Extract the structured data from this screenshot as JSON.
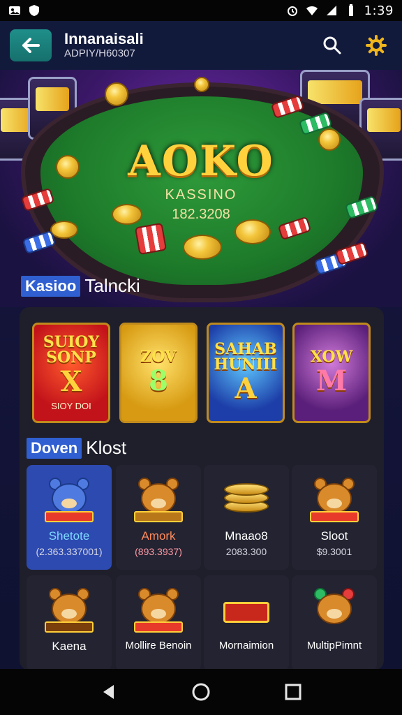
{
  "status_bar": {
    "time": "1:39"
  },
  "header": {
    "title": "Innanaisali",
    "subtitle": "ADPIY/H60307"
  },
  "hero": {
    "logo": "AOKO",
    "subtitle": "KASSINO",
    "amount": "182.3208"
  },
  "section1": {
    "tag": "Kasioo",
    "label": "Talncki"
  },
  "featured": [
    {
      "top": "SUIOY SONP",
      "mid": "X",
      "bottom": "SIOY DOI"
    },
    {
      "top": "ZOV",
      "mid": "8",
      "bottom": ""
    },
    {
      "top": "SAHAB HUNIII",
      "mid": "A",
      "bottom": ""
    },
    {
      "top": "XOW",
      "mid": "M",
      "bottom": ""
    }
  ],
  "section2": {
    "tag": "Doven",
    "label": "Klost"
  },
  "games_row1": [
    {
      "name": "Shetote",
      "value": "(2.363.337001)"
    },
    {
      "name": "Amork",
      "value": "(893.3937)"
    },
    {
      "name": "Mnaao8",
      "value": "2083.300"
    },
    {
      "name": "Sloot",
      "value": "$9.3001"
    }
  ],
  "games_row2": [
    {
      "name": "Kaena"
    },
    {
      "name": "Mollire Benoin"
    },
    {
      "name": "Mornaimion"
    },
    {
      "name": "MultipPimnt"
    }
  ],
  "colors": {
    "accent": "#2f5fd0",
    "gold": "#ffd23d",
    "felt": "#1d7a2a"
  }
}
